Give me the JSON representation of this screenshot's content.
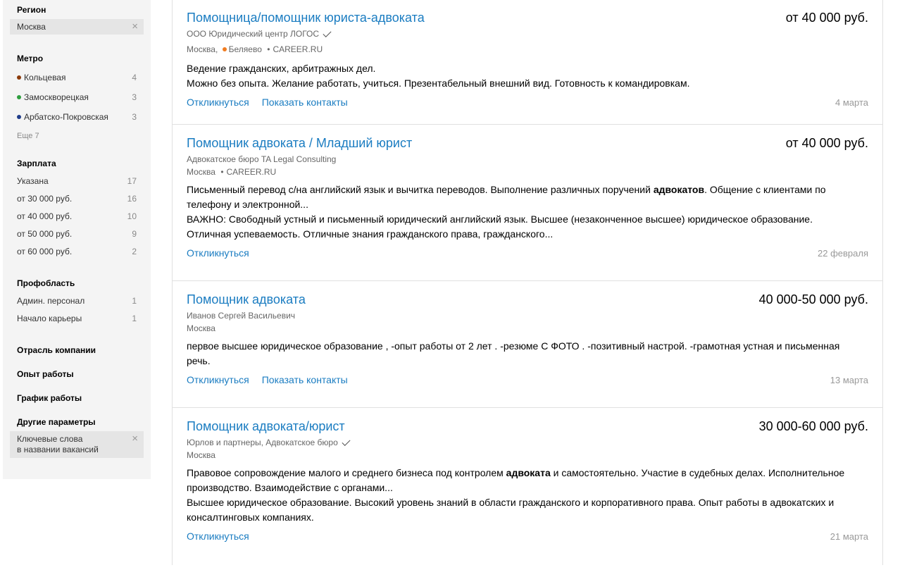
{
  "colors": {
    "link": "#1a7cc1",
    "metro_line_1": "#8b3a0a",
    "metro_line_2": "#2e9e3e",
    "metro_line_3": "#1f3c8a",
    "metro_belyaevo": "#f07c21"
  },
  "sidebar": {
    "region": {
      "title": "Регион",
      "chip": "Москва"
    },
    "metro": {
      "title": "Метро",
      "items": [
        {
          "label": "Кольцевая",
          "count": "4"
        },
        {
          "label": "Замоскворецкая",
          "count": "3"
        },
        {
          "label": "Арбатско-Покровская",
          "count": "3"
        }
      ],
      "more": "Еще 7"
    },
    "salary": {
      "title": "Зарплата",
      "items": [
        {
          "label": "Указана",
          "count": "17"
        },
        {
          "label": "от 30 000 руб.",
          "count": "16"
        },
        {
          "label": "от 40 000 руб.",
          "count": "10"
        },
        {
          "label": "от 50 000 руб.",
          "count": "9"
        },
        {
          "label": "от 60 000 руб.",
          "count": "2"
        }
      ]
    },
    "profarea": {
      "title": "Профобласть",
      "items": [
        {
          "label": "Админ. персонал",
          "count": "1"
        },
        {
          "label": "Начало карьеры",
          "count": "1"
        }
      ]
    },
    "industry": {
      "title": "Отрасль компании"
    },
    "experience": {
      "title": "Опыт работы"
    },
    "schedule": {
      "title": "График работы"
    },
    "other": {
      "title": "Другие параметры",
      "chip_line1": "Ключевые слова",
      "chip_line2": "в названии вакансий"
    }
  },
  "vacancies": [
    {
      "title": "Помощница/помощник юриста-адвоката",
      "salary": "от 40 000 руб.",
      "company": "ООО Юридический центр ЛОГОС",
      "city": "Москва,",
      "metro": "Беляево",
      "sep": "•",
      "source": "CAREER.RU",
      "desc_line1": "Ведение гражданских, арбитражных дел.",
      "desc_line2": "Можно без опыта. Желание работать, учиться. Презентабельный внешний вид. Готовность к командировкам.",
      "respond": "Откликнуться",
      "contacts": "Показать контакты",
      "date": "4 марта"
    },
    {
      "title": "Помощник адвоката / Младший юрист",
      "salary": "от 40 000 руб.",
      "company": "Адвокатское бюро TA Legal Consulting",
      "city": "Москва",
      "sep": "•",
      "source": "CAREER.RU",
      "desc_p1a": "Письменный перевод с/на английский язык и вычитка переводов. Выполнение различных поручений ",
      "desc_p1b": "адвокатов",
      "desc_p1c": ". Общение с клиентами по телефону и электронной...",
      "desc_p2": "ВАЖНО: Свободный устный и письменный юридический английский язык. Высшее (незаконченное высшее) юридическое образование. Отличная успеваемость. Отличные знания гражданского права, гражданского...",
      "respond": "Откликнуться",
      "date": "22 февраля"
    },
    {
      "title": "Помощник адвоката",
      "salary": "40 000-50 000 руб.",
      "company": "Иванов Сергей Васильевич",
      "city": "Москва",
      "desc": "первое высшее юридическое образование , -опыт работы от 2 лет . -резюме С ФОТО . -позитивный настрой. -грамотная устная и письменная речь.",
      "respond": "Откликнуться",
      "contacts": "Показать контакты",
      "date": "13 марта"
    },
    {
      "title": "Помощник адвоката/юрист",
      "salary": "30 000-60 000 руб.",
      "company": "Юрлов и партнеры, Адвокатское бюро",
      "city": "Москва",
      "desc_p1a": "Правовое сопровождение малого и среднего бизнеса под контролем ",
      "desc_p1b": "адвоката",
      "desc_p1c": " и самостоятельно. Участие в судебных делах. Исполнительное производство. Взаимодействие с органами...",
      "desc_p2": "Высшее юридическое образование. Высокий уровень знаний в области гражданского и корпоративного права. Опыт работы в адвокатских и консалтинговых компаниях.",
      "respond": "Откликнуться",
      "date": "21 марта"
    }
  ]
}
